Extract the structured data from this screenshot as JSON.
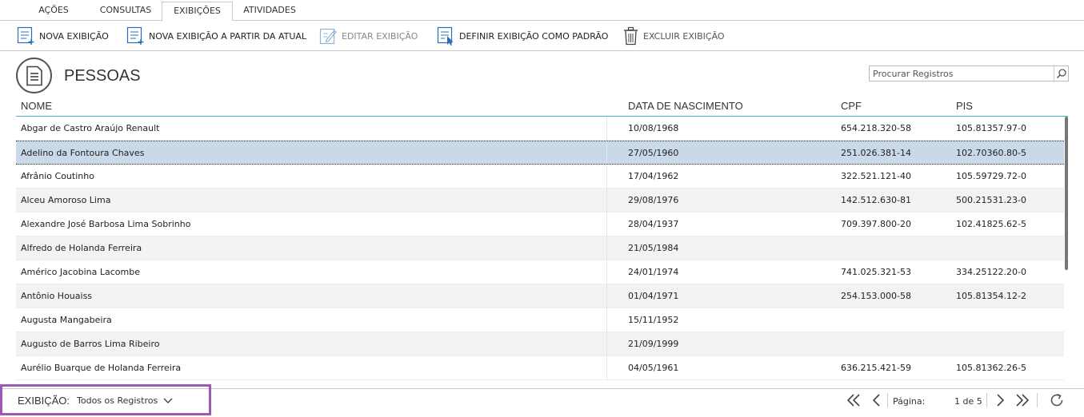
{
  "tabs": [
    {
      "label": "AÇÕES"
    },
    {
      "label": "CONSULTAS"
    },
    {
      "label": "EXIBIÇÕES",
      "active": true
    },
    {
      "label": "ATIVIDADES"
    }
  ],
  "toolbar": {
    "new_view": "NOVA EXIBIÇÃO",
    "new_from_current": "NOVA EXIBIÇÃO A PARTIR DA ATUAL",
    "edit_view": "EDITAR EXIBIÇÃO",
    "set_default": "DEFINIR EXIBIÇÃO COMO PADRÃO",
    "delete_view": "EXCLUIR EXIBIÇÃO"
  },
  "page": {
    "title": "PESSOAS",
    "icon": "document-icon"
  },
  "search": {
    "placeholder": "Procurar Registros",
    "icon": "search-icon"
  },
  "grid": {
    "columns": [
      "NOME",
      "DATA DE NASCIMENTO",
      "CPF",
      "PIS"
    ],
    "selected_row": 1,
    "rows": [
      [
        "Abgar de Castro Araújo Renault",
        "10/08/1968",
        "654.218.320-58",
        "105.81357.97-0"
      ],
      [
        "Adelino da Fontoura Chaves",
        "27/05/1960",
        "251.026.381-14",
        "102.70360.80-5"
      ],
      [
        "Afrânio Coutinho",
        "17/04/1962",
        "322.521.121-40",
        "105.59729.72-0"
      ],
      [
        "Alceu Amoroso Lima",
        "29/08/1976",
        "142.512.630-81",
        "500.21531.23-0"
      ],
      [
        "Alexandre José Barbosa Lima Sobrinho",
        "28/04/1937",
        "709.397.800-20",
        "102.41825.62-5"
      ],
      [
        "Alfredo de Holanda Ferreira",
        "21/05/1984",
        "",
        ""
      ],
      [
        "Américo Jacobina Lacombe",
        "24/01/1974",
        "741.025.321-53",
        "334.25122.20-0"
      ],
      [
        "Antônio Houaiss",
        "01/04/1971",
        "254.153.000-58",
        "105.81354.12-2"
      ],
      [
        "Augusta Mangabeira",
        "15/11/1952",
        "",
        ""
      ],
      [
        "Augusto de Barros Lima Ribeiro",
        "21/09/1999",
        "",
        ""
      ],
      [
        "Aurélio Buarque de Holanda Ferreira",
        "04/05/1961",
        "636.215.421-59",
        "105.81362.26-5"
      ]
    ]
  },
  "footer": {
    "view_label": "EXIBIÇÃO:",
    "view_value": "Todos os Registros",
    "page_label": "Página:",
    "page_value": "1 de 5"
  },
  "colors": {
    "header_underline": "#4fb8c6",
    "selected_row": "#c9d9e7",
    "alt_row": "#f3f3f3",
    "highlight_box": "#9b59b6"
  }
}
